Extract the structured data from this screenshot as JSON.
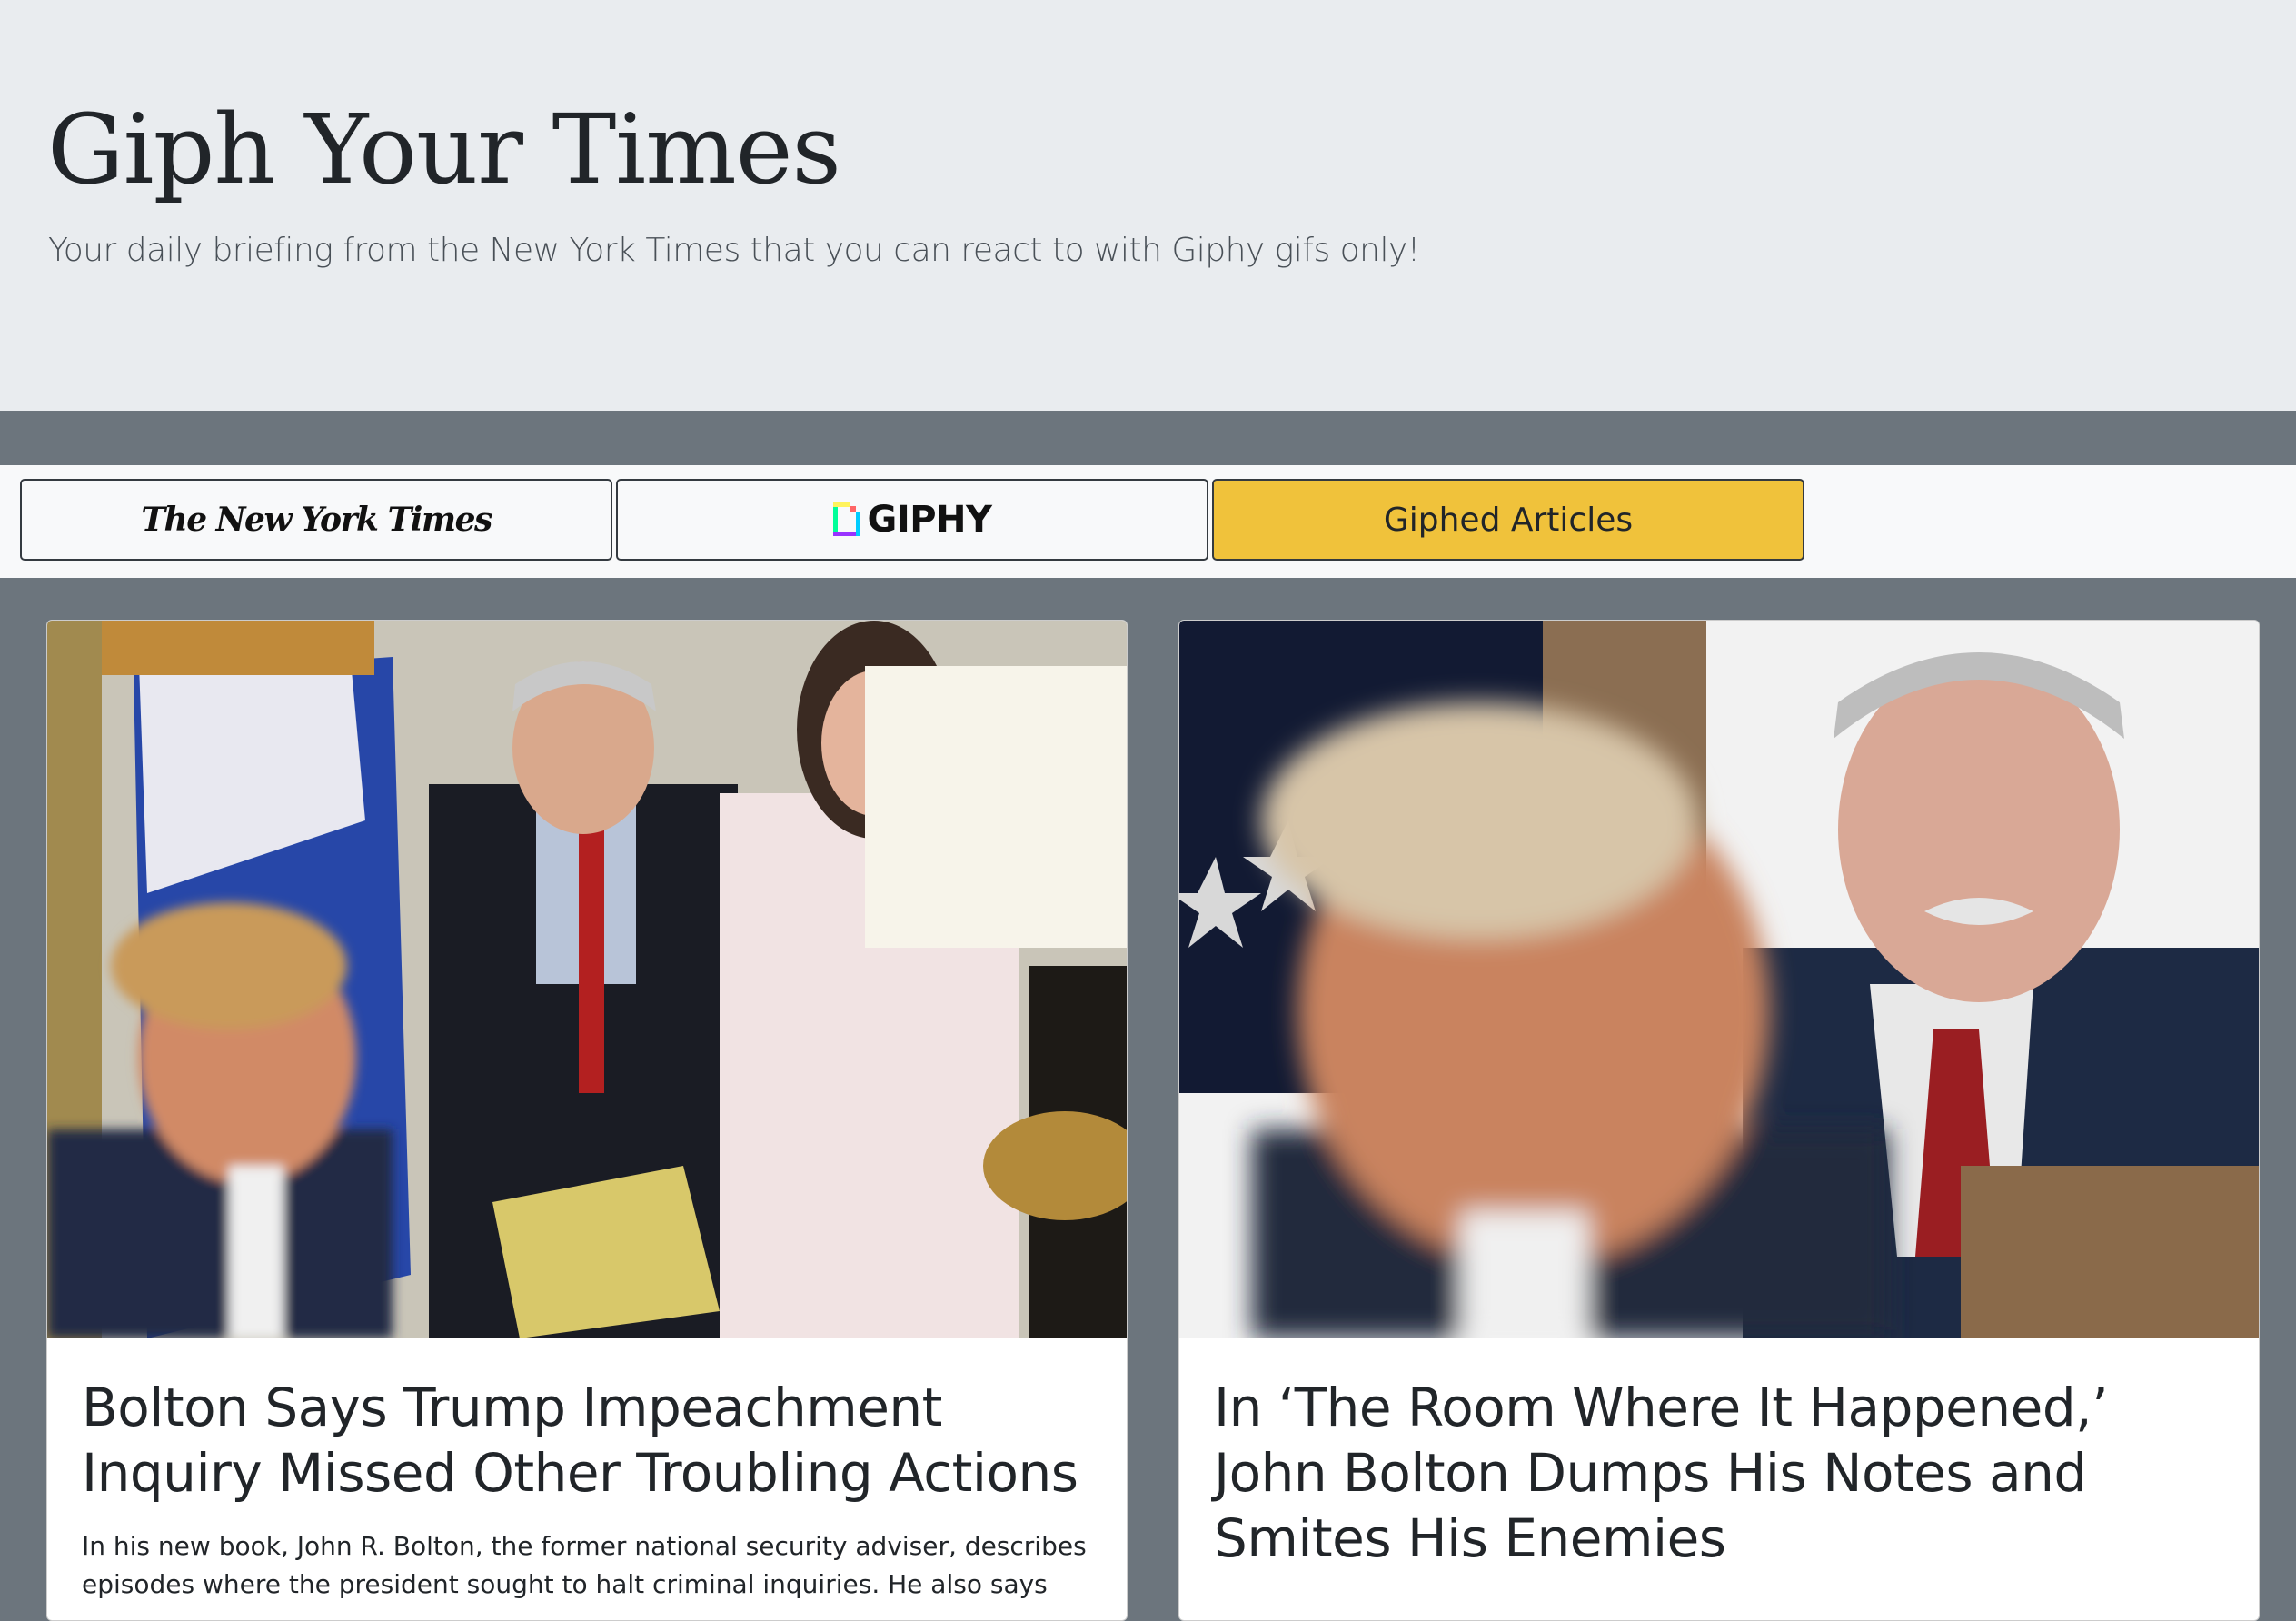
{
  "header": {
    "title": "Giph Your Times",
    "subtitle": "Your daily briefing from the New York Times that you can react to with Giphy gifs only!"
  },
  "nav": {
    "nyt_label": "The New York Times",
    "giphy_label": "GIPHY",
    "giphed_label": "Giphed Articles"
  },
  "articles": [
    {
      "title": "Bolton Says Trump Impeachment Inquiry Missed Other Troubling Actions",
      "abstract": "In his new book, John R. Bolton, the former national security adviser, describes episodes where the president sought to halt criminal inquiries. He also says"
    },
    {
      "title": "In ‘The Room Where It Happened,’ John Bolton Dumps His Notes and Smites His Enemies",
      "abstract": ""
    }
  ],
  "colors": {
    "hero_bg": "#e9ecef",
    "page_bg": "#6c757d",
    "nav_bg": "#f8f9fa",
    "giphed_button": "#f0c23b"
  },
  "icons": [
    "giphy-logo-icon"
  ]
}
